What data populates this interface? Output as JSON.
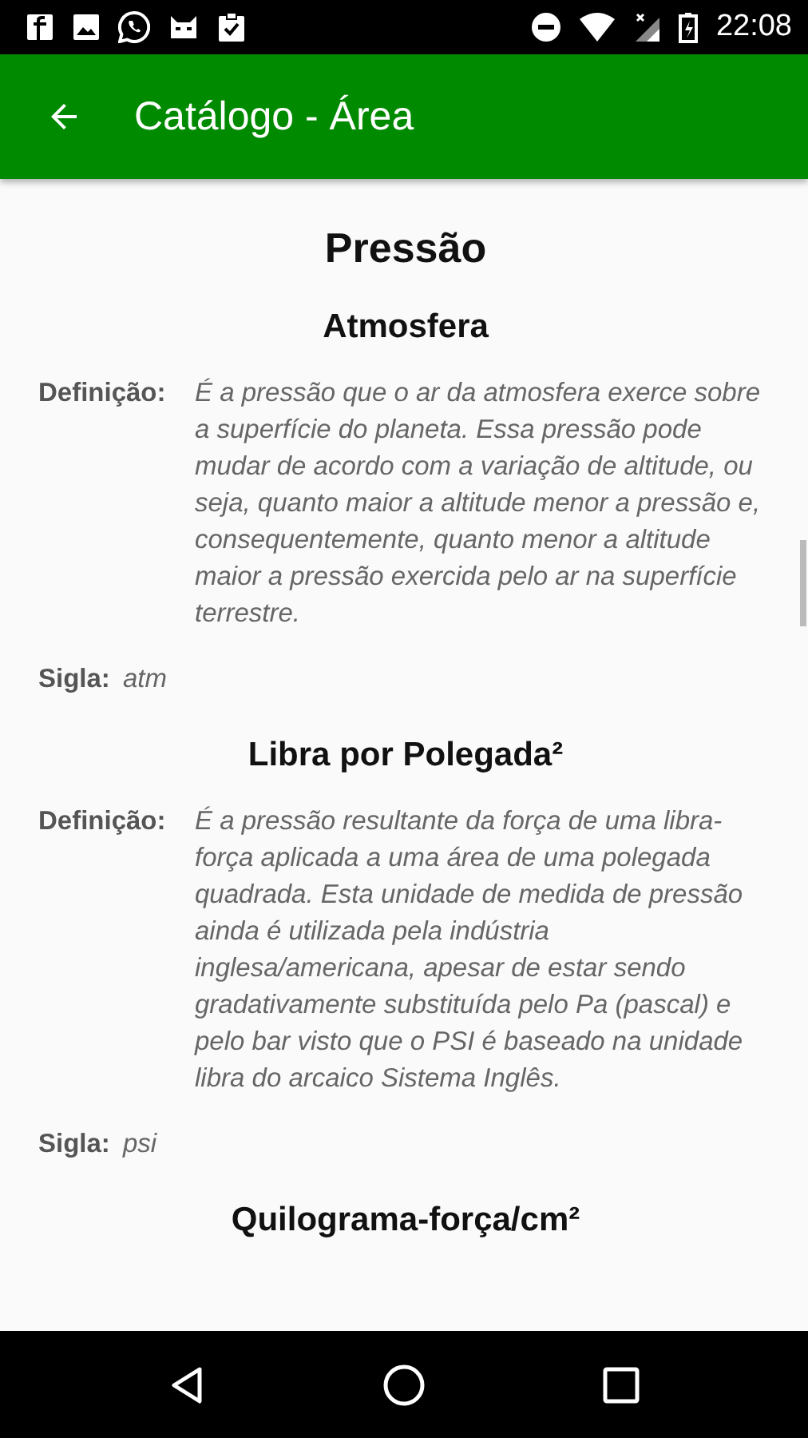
{
  "status_bar": {
    "time": "22:08"
  },
  "app_bar": {
    "title": "Catálogo - Área"
  },
  "page": {
    "title": "Pressão"
  },
  "entries": [
    {
      "heading": "Atmosfera",
      "definition_label": "Definição:",
      "definition": "É a pressão que o ar da atmosfera exerce sobre a superfície do planeta. Essa pressão pode mudar de acordo com a variação de altitude, ou seja, quanto maior a altitude menor a pressão e, consequentemente, quanto menor a altitude maior a pressão exercida pelo ar na superfície terrestre.",
      "sigla_label": "Sigla:",
      "sigla": "atm"
    },
    {
      "heading": "Libra por Polegada²",
      "definition_label": "Definição:",
      "definition": "É a pressão resultante da força de uma libra-força aplicada a uma área de uma polegada quadrada. Esta unidade de medida de pressão ainda é utilizada pela indústria inglesa/americana, apesar de estar sendo gradativamente substituída pelo Pa (pascal) e pelo bar visto que o PSI é baseado na unidade libra do arcaico Sistema Inglês.",
      "sigla_label": "Sigla:",
      "sigla": "psi"
    },
    {
      "heading": "Quilograma-força/cm²"
    }
  ]
}
